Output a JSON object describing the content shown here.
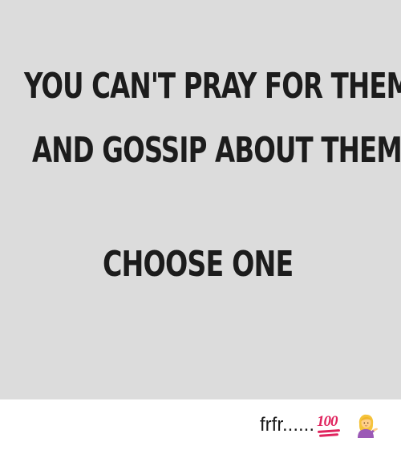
{
  "meme": {
    "line1": "YOU CAN'T PRAY FOR THEM",
    "line2": "AND GOSSIP ABOUT THEM",
    "line3": "CHOOSE ONE"
  },
  "caption": {
    "text": "frfr......",
    "emoji": [
      "hundred-points-icon",
      "person-tipping-hand-icon"
    ]
  },
  "colors": {
    "panel_background": "#dcdcdc",
    "text": "#1c1c1c",
    "hundred_red": "#e0245e",
    "hair": "#f5c33b",
    "shirt": "#9b59b6"
  }
}
